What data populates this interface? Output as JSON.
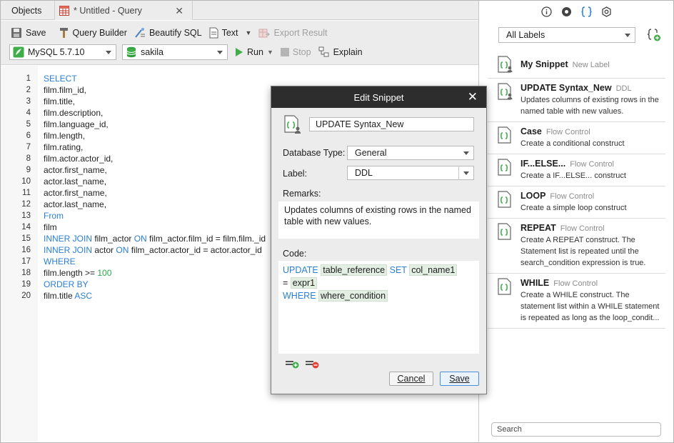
{
  "tabs": {
    "objects": "Objects",
    "query": "* Untitled - Query"
  },
  "toolbar": {
    "save": "Save",
    "query_builder": "Query Builder",
    "beautify_sql": "Beautify SQL",
    "text": "Text",
    "export_result": "Export Result",
    "connection": "MySQL 5.7.10",
    "database": "sakila",
    "run": "Run",
    "stop": "Stop",
    "explain": "Explain"
  },
  "editor": {
    "lines": [
      {
        "n": "1",
        "t": "SELECT"
      },
      {
        "n": "2",
        "t": "film.film_id,"
      },
      {
        "n": "3",
        "t": "film.title,"
      },
      {
        "n": "4",
        "t": "film.description,"
      },
      {
        "n": "5",
        "t": "film.language_id,"
      },
      {
        "n": "6",
        "t": "film.length,"
      },
      {
        "n": "7",
        "t": "film.rating,"
      },
      {
        "n": "8",
        "t": "film.actor.actor_id,"
      },
      {
        "n": "9",
        "t": "actor.first_name,"
      },
      {
        "n": "10",
        "t": "actor.last_name,"
      },
      {
        "n": "11",
        "t": "actor.first_name,"
      },
      {
        "n": "12",
        "t": "actor.last_name,"
      },
      {
        "n": "13",
        "t": "From"
      },
      {
        "n": "14",
        "t": "film"
      },
      {
        "n": "15",
        "t": "INNER JOIN film_actor ON film_actor.film_id = film.film._id"
      },
      {
        "n": "16",
        "t": "INNER JOIN actor ON film_actor.actor_id = actor.actor_id"
      },
      {
        "n": "17",
        "t": "WHERE"
      },
      {
        "n": "18",
        "t": "film.length >= 100"
      },
      {
        "n": "19",
        "t": "ORDER BY"
      },
      {
        "n": "20",
        "t": "film.title ASC"
      }
    ]
  },
  "dialog": {
    "title": "Edit Snippet",
    "name": "UPDATE Syntax_New",
    "database_type_label": "Database Type:",
    "database_type": "General",
    "label_label": "Label:",
    "label": "DDL",
    "remarks_label": "Remarks:",
    "remarks": "Updates columns of existing rows in the named table with new values.",
    "code_label": "Code:",
    "code": {
      "update": "UPDATE",
      "table_reference": "table_reference",
      "set": "SET",
      "col_name1": "col_name1",
      "equals": "=",
      "expr1": "expr1",
      "where": "WHERE",
      "where_condition": "where_condition"
    },
    "cancel": "Cancel",
    "save": "Save"
  },
  "right_panel": {
    "labels_filter": "All Labels",
    "search_placeholder": "Search",
    "snippets": [
      {
        "title": "My Snippet",
        "label": "New Label",
        "desc": ""
      },
      {
        "title": "UPDATE Syntax_New",
        "label": "DDL",
        "desc": "Updates columns of existing rows in the named table with new values."
      },
      {
        "title": "Case",
        "label": "Flow Control",
        "desc": "Create a conditional construct"
      },
      {
        "title": "IF...ELSE...",
        "label": "Flow Control",
        "desc": "Create a IF...ELSE... construct"
      },
      {
        "title": "LOOP",
        "label": "Flow Control",
        "desc": "Create a simple loop construct"
      },
      {
        "title": "REPEAT",
        "label": "Flow Control",
        "desc": "Create A REPEAT construct. The Statement list is repeated until the search_condition expression is true."
      },
      {
        "title": "WHILE",
        "label": "Flow Control",
        "desc": "Create a WHILE construct. The statement list within a WHILE statement is repeated as long as the loop_condit..."
      }
    ]
  },
  "colors": {
    "keyword": "#2b7fd4",
    "number": "#2aa84a",
    "dialog_title_bg": "#2d2d2d",
    "placeholder_bg": "#e2efe2"
  }
}
